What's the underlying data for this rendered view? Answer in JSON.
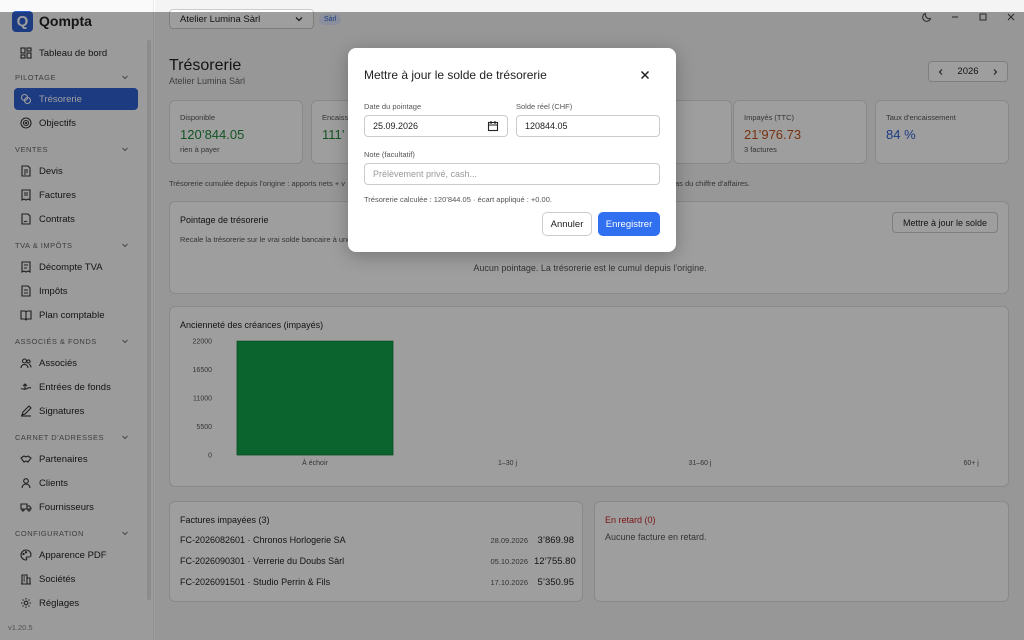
{
  "app": {
    "name": "Qompta",
    "logo_letter": "Q",
    "version": "v1.20.5"
  },
  "colors": {
    "accent": "#2f5fd0",
    "positive": "#1f8a3a",
    "warning": "#c0531a",
    "danger": "#c62828",
    "bar": "#12a04a"
  },
  "sidebar": {
    "dashboard": "Tableau de bord",
    "sections": [
      {
        "label": "PILOTAGE",
        "items": [
          {
            "label": "Trésorerie",
            "icon": "coins-icon",
            "active": true
          },
          {
            "label": "Objectifs",
            "icon": "target-icon"
          }
        ]
      },
      {
        "label": "VENTES",
        "items": [
          {
            "label": "Devis",
            "icon": "quote-doc-icon"
          },
          {
            "label": "Factures",
            "icon": "invoice-icon"
          },
          {
            "label": "Contrats",
            "icon": "contract-icon"
          }
        ]
      },
      {
        "label": "TVA & IMPÔTS",
        "items": [
          {
            "label": "Décompte TVA",
            "icon": "receipt-icon"
          },
          {
            "label": "Impôts",
            "icon": "tax-doc-icon"
          },
          {
            "label": "Plan comptable",
            "icon": "book-icon"
          }
        ]
      },
      {
        "label": "ASSOCIÉS & FONDS",
        "items": [
          {
            "label": "Associés",
            "icon": "users-icon"
          },
          {
            "label": "Entrées de fonds",
            "icon": "money-in-icon"
          },
          {
            "label": "Signatures",
            "icon": "pen-icon"
          }
        ]
      },
      {
        "label": "CARNET D'ADRESSES",
        "items": [
          {
            "label": "Partenaires",
            "icon": "handshake-icon"
          },
          {
            "label": "Clients",
            "icon": "user-icon"
          },
          {
            "label": "Fournisseurs",
            "icon": "truck-icon"
          }
        ]
      },
      {
        "label": "CONFIGURATION",
        "items": [
          {
            "label": "Apparence PDF",
            "icon": "palette-icon"
          },
          {
            "label": "Sociétés",
            "icon": "building-icon"
          },
          {
            "label": "Réglages",
            "icon": "gear-icon"
          }
        ]
      }
    ]
  },
  "topbar": {
    "company": "Atelier Lumina Sàrl",
    "company_type": "Sàrl"
  },
  "page": {
    "title": "Trésorerie",
    "subtitle": "Atelier Lumina Sàrl",
    "year": "2026"
  },
  "kpis": [
    {
      "label": "Disponible",
      "value": "120’844.05",
      "sub": "rien à payer",
      "color": "#1f8a3a"
    },
    {
      "label": "Encaissé",
      "value": "111’",
      "sub": "",
      "color": "#1f8a3a"
    },
    {
      "label": "Impayés (TTC)",
      "value": "21’976.73",
      "sub": "3 factures",
      "color": "#c0531a"
    },
    {
      "label": "Taux d'encaissement",
      "value": "84 %",
      "sub": "",
      "color": "#2f5fd0"
    }
  ],
  "notes": {
    "left": "Trésorerie cumulée depuis l'origine : apports nets + v",
    "right": "as du chiffre d'affaires."
  },
  "pointage": {
    "title": "Pointage de trésorerie",
    "description": "Recale la trésorerie sur le vrai solde bancaire à une",
    "button": "Mettre à jour le solde",
    "empty": "Aucun pointage. La trésorerie est le cumul depuis l'origine."
  },
  "chart_data": {
    "type": "bar",
    "title": "Ancienneté des créances (impayés)",
    "categories": [
      "À échoir",
      "1–30 j",
      "31–60 j",
      "60+ j"
    ],
    "values": [
      21976.73,
      0,
      0,
      0
    ],
    "ylim": [
      0,
      22000
    ],
    "yticks": [
      "22000",
      "16500",
      "11000",
      "5500",
      "0"
    ],
    "xlabel": "",
    "ylabel": ""
  },
  "unpaid": {
    "title": "Factures impayées (3)",
    "rows": [
      {
        "id": "FC-2026082601 · Chronos Horlogerie SA",
        "date": "28.09.2026",
        "amount": "3’869.98"
      },
      {
        "id": "FC-2026090301 · Verrerie du Doubs Sàrl",
        "date": "05.10.2026",
        "amount": "12’755.80"
      },
      {
        "id": "FC-2026091501 · Studio Perrin & Fils",
        "date": "17.10.2026",
        "amount": "5’350.95"
      }
    ]
  },
  "late": {
    "title": "En retard (0)",
    "empty": "Aucune facture en retard."
  },
  "modal": {
    "title": "Mettre à jour le solde de trésorerie",
    "date_label": "Date du pointage",
    "date_value": "25.09.2026",
    "balance_label": "Solde réel (CHF)",
    "balance_value": "120844.05",
    "note_label": "Note (facultatif)",
    "note_placeholder": "Prélèvement privé, cash...",
    "calc": "Trésorerie calculée : 120’844.05 · écart appliqué : +0.00.",
    "cancel": "Annuler",
    "save": "Enregistrer"
  }
}
